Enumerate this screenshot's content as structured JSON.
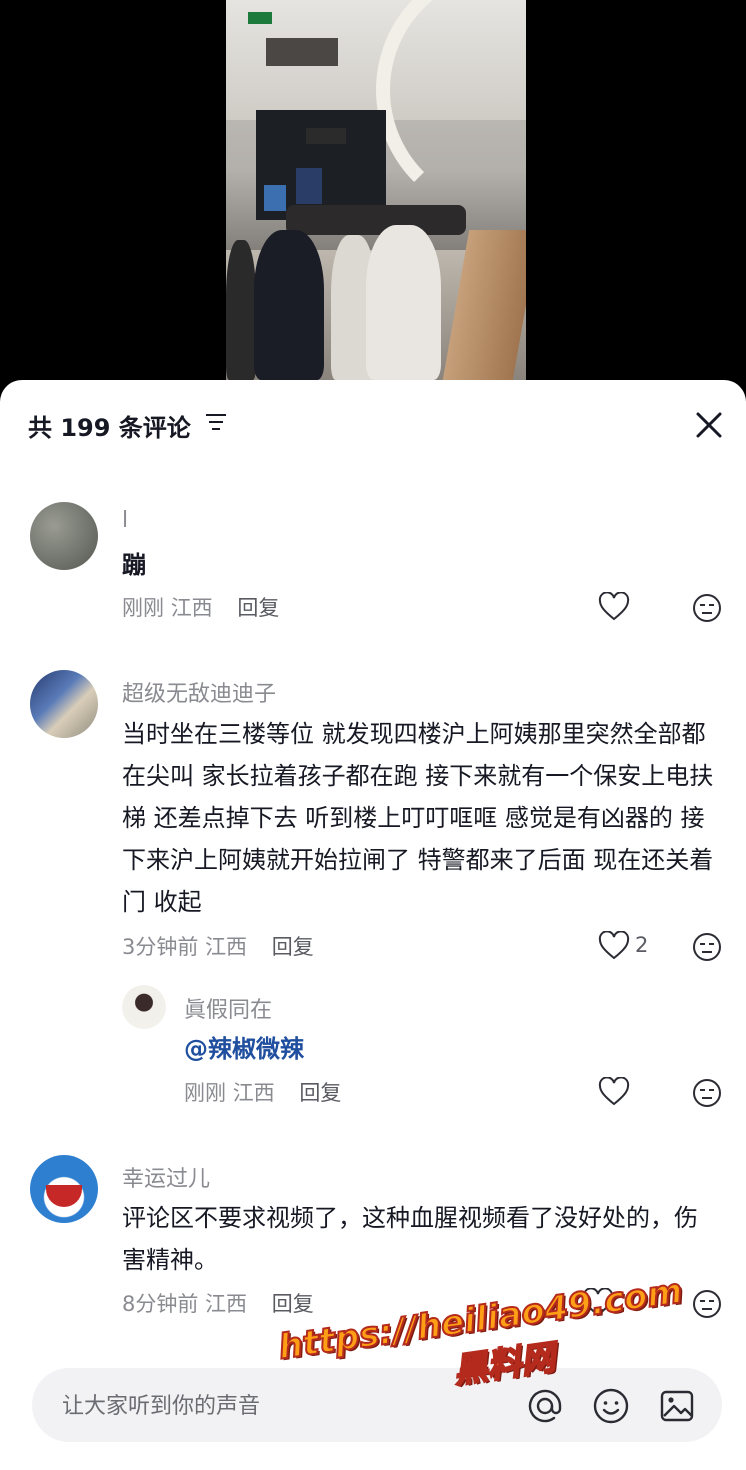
{
  "header": {
    "comment_count_title": "共 199 条评论"
  },
  "comments": [
    {
      "username": "l",
      "text": "蹦",
      "time": "刚刚",
      "location": "江西",
      "reply_label": "回复",
      "likes": ""
    },
    {
      "username": "超级无敌迪迪子",
      "text": "当时坐在三楼等位 就发现四楼沪上阿姨那里突然全部都在尖叫 家长拉着孩子都在跑 接下来就有一个保安上电扶梯 还差点掉下去 听到楼上叮叮哐哐 感觉是有凶器的 接下来沪上阿姨就开始拉闸了 特警都来了后面 现在还关着门 收起",
      "time": "3分钟前",
      "location": "江西",
      "reply_label": "回复",
      "likes": "2",
      "replies": [
        {
          "username": "眞假同在",
          "mention": "@辣椒微辣",
          "time": "刚刚",
          "location": "江西",
          "reply_label": "回复"
        }
      ]
    },
    {
      "username": "幸运过儿",
      "text": "评论区不要求视频了，这种血腥视频看了没好处的，伤害精神。",
      "time": "8分钟前",
      "location": "江西",
      "reply_label": "回复",
      "likes": ""
    }
  ],
  "input": {
    "placeholder": "让大家听到你的声音"
  },
  "watermark": {
    "url": "https://heiliao49.com",
    "name": "黑料网"
  },
  "icons": {
    "close": "close-icon",
    "filter": "filter-icon",
    "heart": "heart-icon",
    "dislike": "dislike-face-icon",
    "at": "at-icon",
    "emoji": "emoji-icon",
    "image": "image-icon"
  }
}
